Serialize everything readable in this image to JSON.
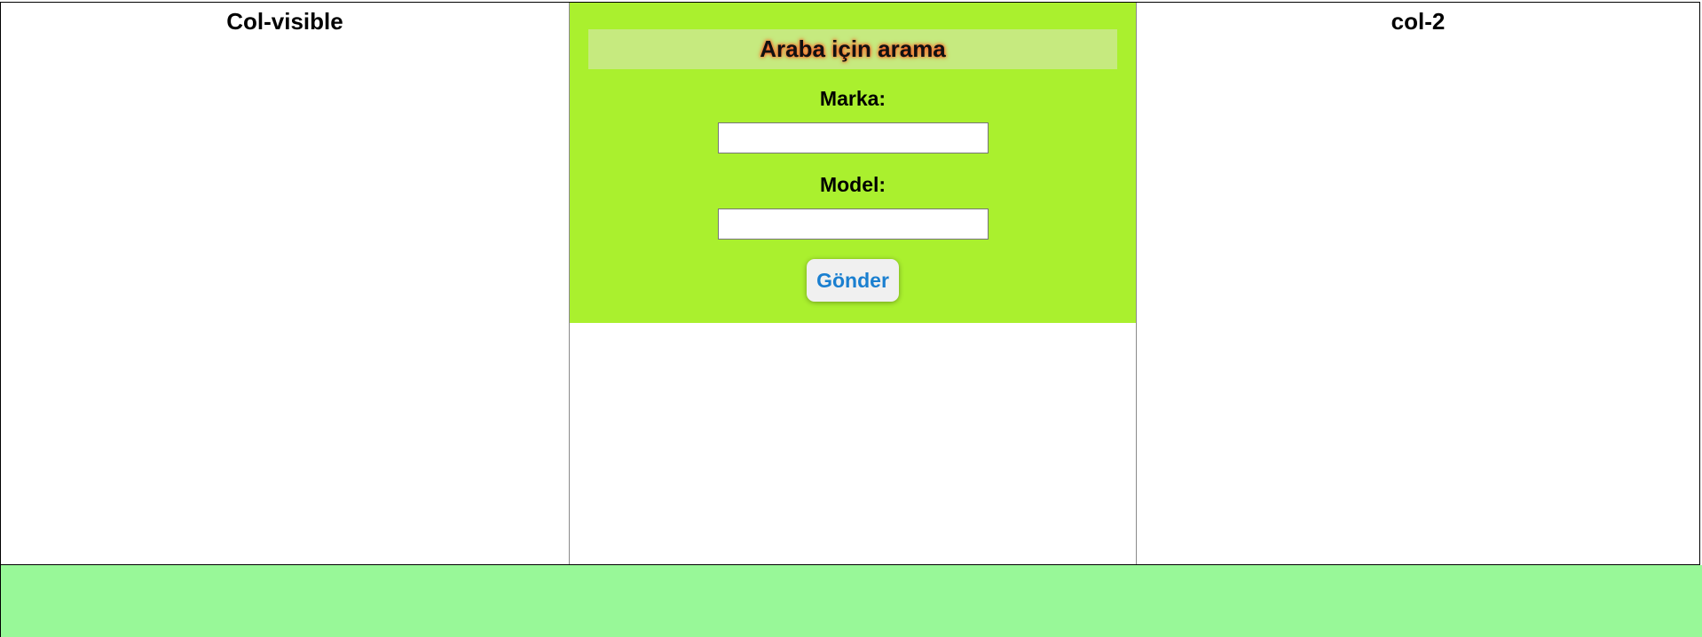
{
  "columns": {
    "left_title": "Col-visible",
    "right_title": "col-2"
  },
  "search_form": {
    "heading": "Araba için arama",
    "brand_label": "Marka:",
    "brand_value": "",
    "model_label": "Model:",
    "model_value": "",
    "submit_label": "Gönder"
  },
  "colors": {
    "panel_background": "#aaf02e",
    "heading_background": "#c6ea7f",
    "heading_glow": "#ff5a1f",
    "button_text": "#1a7fd0",
    "footer_background": "#98f898",
    "column_border": "#8a8a8a"
  }
}
